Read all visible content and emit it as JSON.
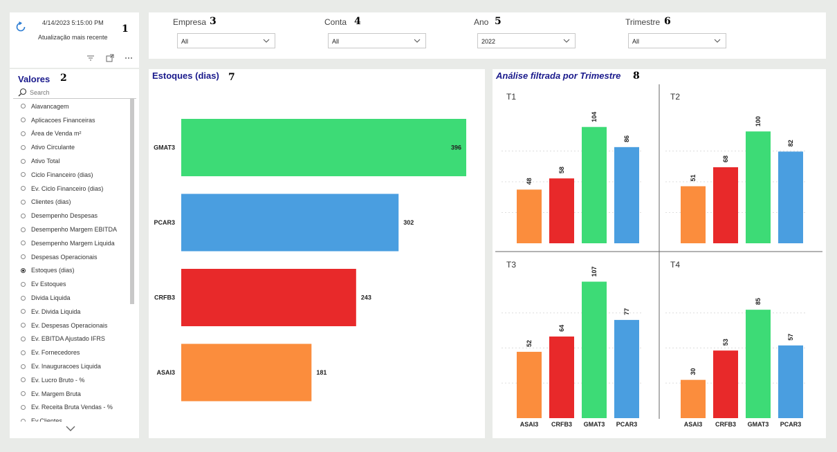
{
  "refresh": {
    "timestamp": "4/14/2023 5:15:00 PM",
    "label": "Atualização mais recente",
    "badge": "1"
  },
  "slicer": {
    "title": "Valores",
    "badge": "2",
    "search_placeholder": "Search",
    "items": [
      {
        "label": "Alavancagem",
        "selected": false
      },
      {
        "label": "Aplicacoes Financeiras",
        "selected": false
      },
      {
        "label": "Área de Venda m²",
        "selected": false
      },
      {
        "label": "Ativo Circulante",
        "selected": false
      },
      {
        "label": "Ativo Total",
        "selected": false
      },
      {
        "label": "Ciclo Financeiro (dias)",
        "selected": false
      },
      {
        "label": "Ev. Ciclo Financeiro (dias)",
        "selected": false
      },
      {
        "label": "Clientes (dias)",
        "selected": false
      },
      {
        "label": "Desempenho Despesas",
        "selected": false
      },
      {
        "label": "Desempenho Margem EBITDA",
        "selected": false
      },
      {
        "label": "Desempenho Margem Liquida",
        "selected": false
      },
      {
        "label": "Despesas Operacionais",
        "selected": false
      },
      {
        "label": "Estoques (dias)",
        "selected": true
      },
      {
        "label": "Ev Estoques",
        "selected": false
      },
      {
        "label": "Divida Liquida",
        "selected": false
      },
      {
        "label": "Ev. Divida Liquida",
        "selected": false
      },
      {
        "label": "Ev. Despesas Operacionais",
        "selected": false
      },
      {
        "label": "Ev. EBITDA Ajustado IFRS",
        "selected": false
      },
      {
        "label": "Ev. Fornecedores",
        "selected": false
      },
      {
        "label": "Ev. Inauguracoes Liquida",
        "selected": false
      },
      {
        "label": "Ev. Lucro Bruto - %",
        "selected": false
      },
      {
        "label": "Ev. Margem Bruta",
        "selected": false
      },
      {
        "label": "Ev. Receita Bruta Vendas - %",
        "selected": false
      },
      {
        "label": "Ev.Clientes",
        "selected": false
      }
    ]
  },
  "filters": [
    {
      "label": "Empresa",
      "badge": "3",
      "value": "All"
    },
    {
      "label": "Conta",
      "badge": "4",
      "value": "All"
    },
    {
      "label": "Ano",
      "badge": "5",
      "value": "2022"
    },
    {
      "label": "Trimestre",
      "badge": "6",
      "value": "All"
    }
  ],
  "bar_chart": {
    "title": "Estoques (dias)",
    "badge": "7"
  },
  "quarter_chart": {
    "title": "Análise filtrada por Trimestre",
    "badge": "8"
  },
  "icons": {
    "refresh": "refresh-icon",
    "filter": "filter-icon",
    "focus": "focus-mode-icon",
    "more": "more-options-icon",
    "search": "search-icon",
    "dropdown": "chevron-down-icon"
  },
  "chart_data": [
    {
      "type": "bar",
      "orientation": "horizontal",
      "title": "Estoques (dias)",
      "categories": [
        "GMAT3",
        "PCAR3",
        "CRFB3",
        "ASAI3"
      ],
      "values": [
        396,
        302,
        243,
        181
      ],
      "colors": [
        "#3ddb76",
        "#4a9ee0",
        "#e8292a",
        "#fb8d3d"
      ]
    },
    {
      "type": "bar",
      "title": "Análise filtrada por Trimestre",
      "categories": [
        "ASAI3",
        "CRFB3",
        "GMAT3",
        "PCAR3"
      ],
      "colors": [
        "#fb8d3d",
        "#e8292a",
        "#3ddb76",
        "#4a9ee0"
      ],
      "panels": [
        {
          "name": "T1",
          "values": [
            48,
            58,
            104,
            86
          ]
        },
        {
          "name": "T2",
          "values": [
            51,
            68,
            100,
            82
          ]
        },
        {
          "name": "T3",
          "values": [
            52,
            64,
            107,
            77
          ]
        },
        {
          "name": "T4",
          "values": [
            30,
            53,
            85,
            57
          ]
        }
      ]
    }
  ]
}
